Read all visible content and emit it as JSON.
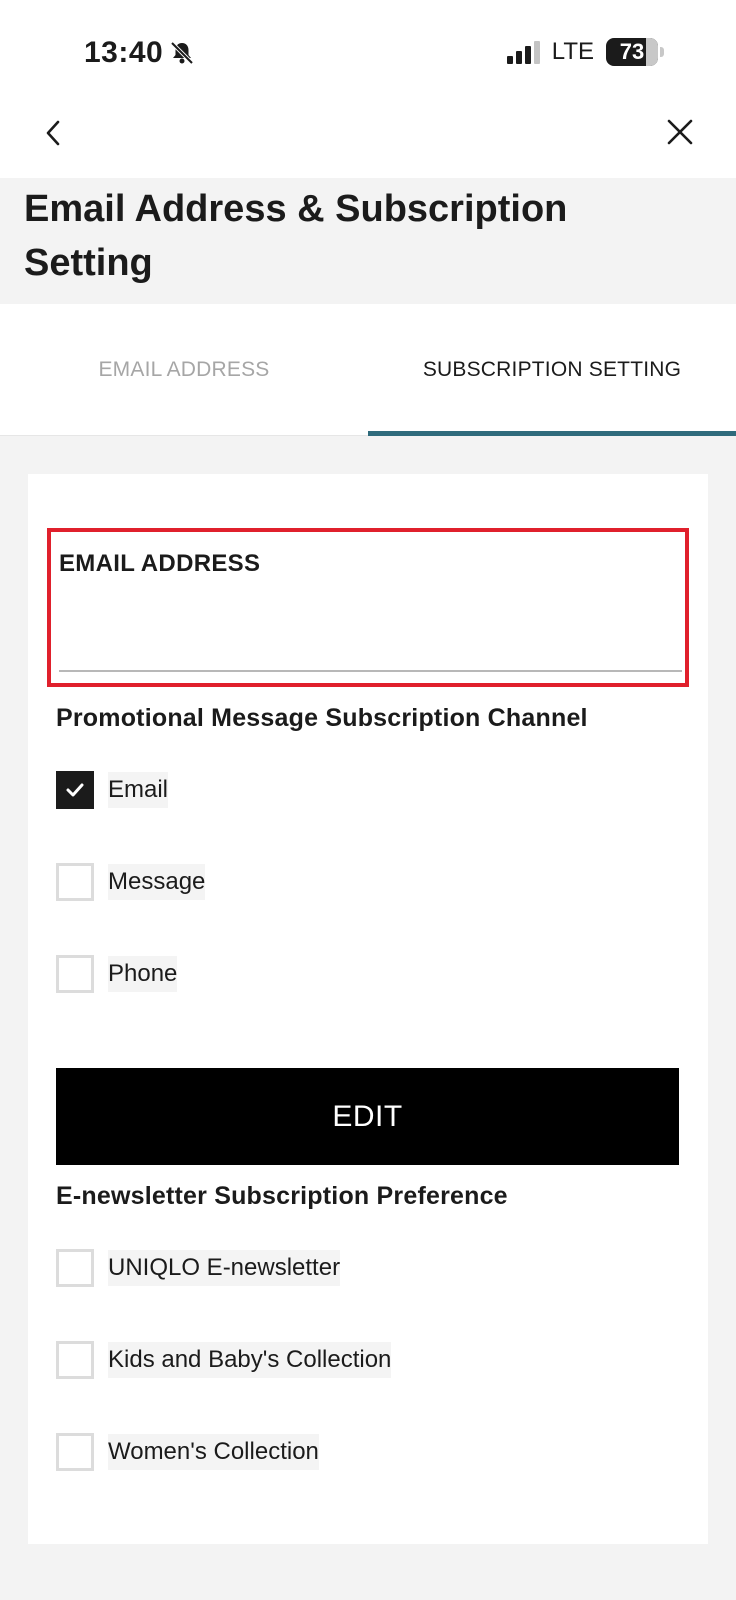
{
  "status_bar": {
    "time": "13:40",
    "network": "LTE",
    "battery": "73"
  },
  "page": {
    "title": "Email Address & Subscription Setting"
  },
  "tabs": [
    {
      "label": "EMAIL ADDRESS",
      "active": false
    },
    {
      "label": "SUBSCRIPTION SETTING",
      "active": true
    }
  ],
  "email_field": {
    "label": "EMAIL ADDRESS",
    "value": ""
  },
  "promo_channel": {
    "heading": "Promotional Message Subscription Channel",
    "options": [
      {
        "label": "Email",
        "checked": true
      },
      {
        "label": "Message",
        "checked": false
      },
      {
        "label": "Phone",
        "checked": false
      }
    ]
  },
  "edit_button": {
    "label": "EDIT"
  },
  "newsletter": {
    "heading": "E-newsletter Subscription Preference",
    "options": [
      {
        "label": "UNIQLO E-newsletter",
        "checked": false
      },
      {
        "label": "Kids and Baby's Collection",
        "checked": false
      },
      {
        "label": "Women's Collection",
        "checked": false
      }
    ]
  },
  "colors": {
    "tab_underline": "#2f6b7c",
    "highlight_border": "#e0202c",
    "button_bg": "#000000"
  }
}
